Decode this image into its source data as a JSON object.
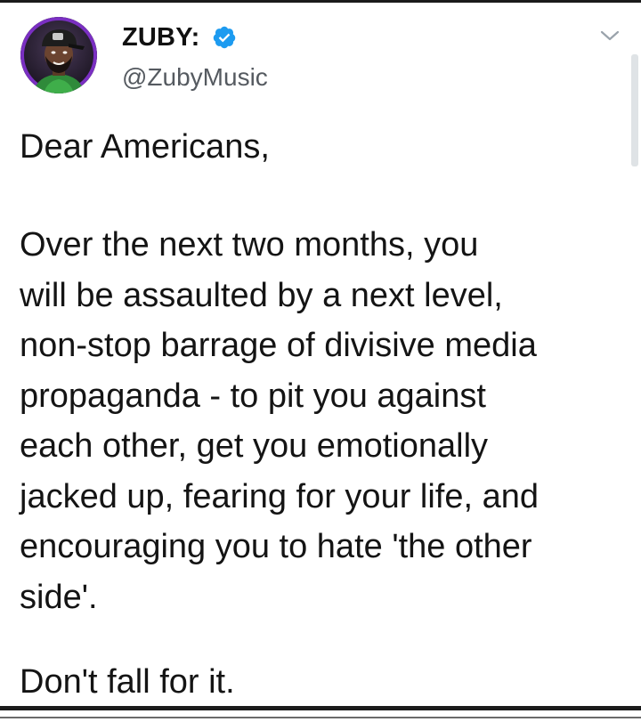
{
  "tweet": {
    "author": {
      "name": "ZUBY:",
      "handle": "@ZubyMusic",
      "verified": true
    },
    "greeting": "Dear Americans,",
    "body_lines": [
      "Over the next two months, you",
      "will be assaulted by a next level,",
      "non-stop barrage of divisive media",
      "propaganda - to pit you against",
      "each other, get you emotionally",
      "jacked up, fearing for your life, and",
      "encouraging you to hate 'the other",
      "side'."
    ],
    "closing": "Don't fall for it."
  },
  "icons": {
    "verified": "verified-badge-icon",
    "menu": "chevron-down-icon"
  },
  "colors": {
    "text": "#141414",
    "handle": "#555a60",
    "verified": "#1d9bf0",
    "avatar_ring": "#7a2fc2"
  }
}
